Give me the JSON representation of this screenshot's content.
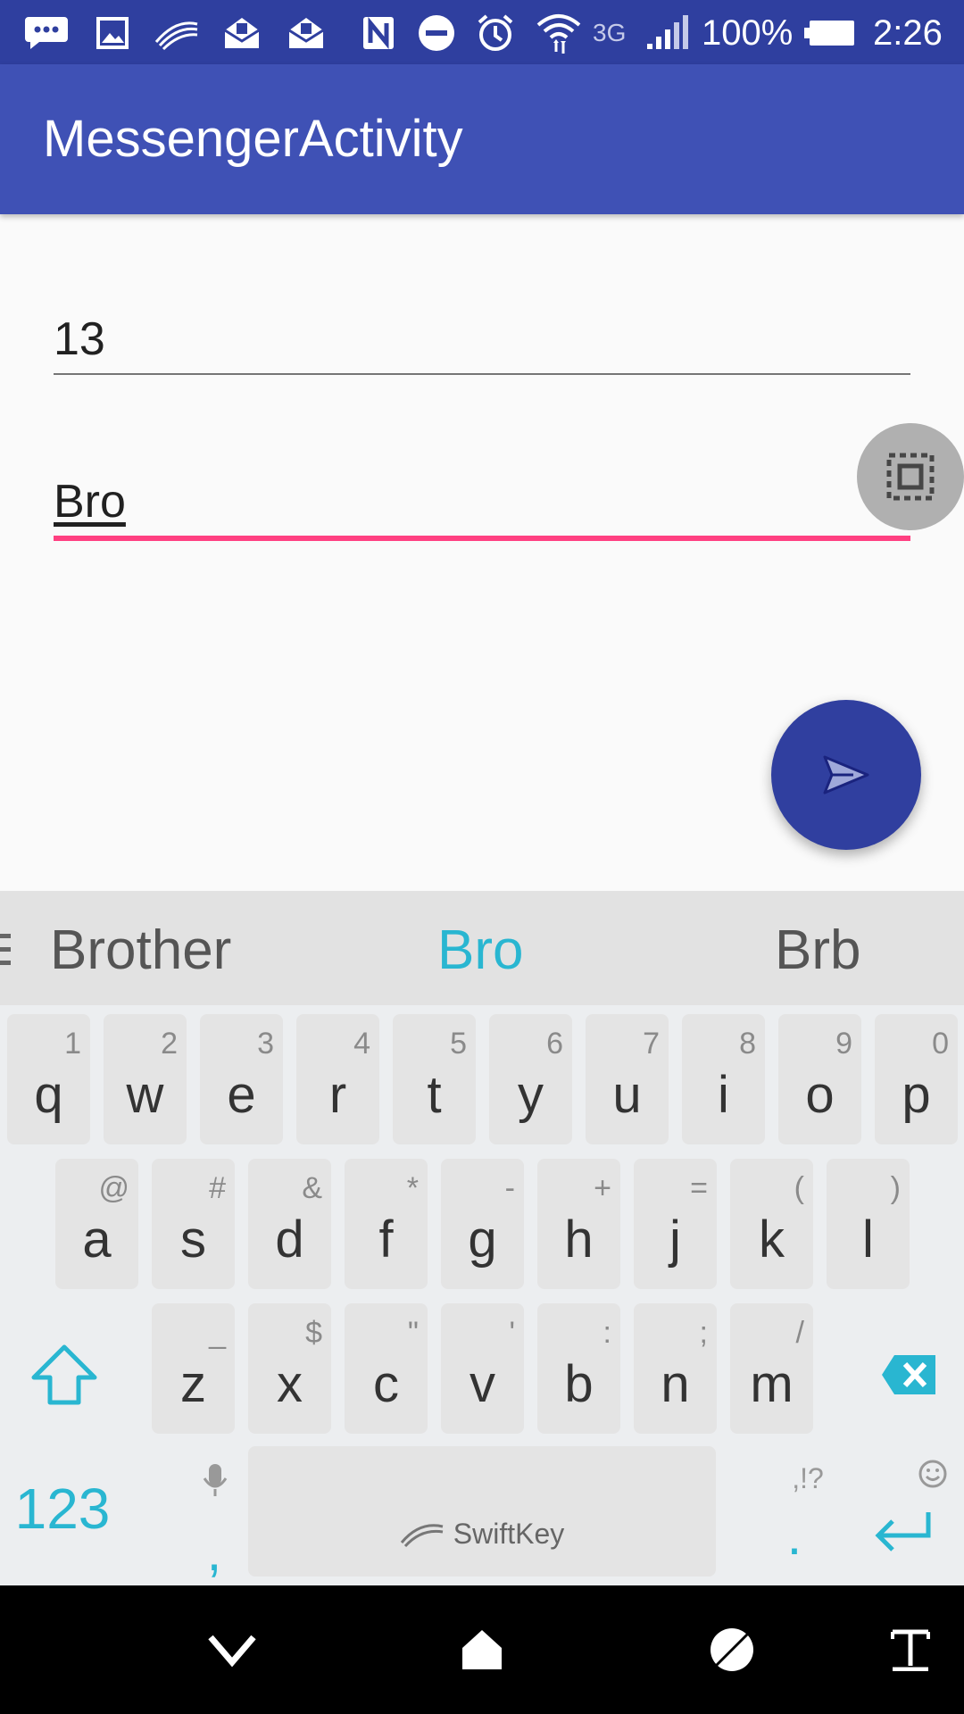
{
  "status_bar": {
    "network_type": "3G",
    "battery": "100%",
    "time": "2:26",
    "icons": [
      "more-icon",
      "image-icon",
      "swiftkey-icon",
      "email-icon",
      "email-icon",
      "nfc-icon",
      "do-not-disturb-icon",
      "alarm-icon",
      "wifi-icon",
      "signal-icon",
      "battery-icon"
    ]
  },
  "app_bar": {
    "title": "MessengerActivity"
  },
  "form": {
    "field1_value": "13",
    "field2_value": "Bro"
  },
  "colors": {
    "primary": "#3f51b5",
    "primary_dark": "#303f9f",
    "accent": "#ff4081",
    "keyboard_accent": "#29b6d1"
  },
  "keyboard": {
    "suggestions": [
      "Brother",
      "Bro",
      "Brb"
    ],
    "row1": [
      {
        "key": "q",
        "hint": "1"
      },
      {
        "key": "w",
        "hint": "2"
      },
      {
        "key": "e",
        "hint": "3"
      },
      {
        "key": "r",
        "hint": "4"
      },
      {
        "key": "t",
        "hint": "5"
      },
      {
        "key": "y",
        "hint": "6"
      },
      {
        "key": "u",
        "hint": "7"
      },
      {
        "key": "i",
        "hint": "8"
      },
      {
        "key": "o",
        "hint": "9"
      },
      {
        "key": "p",
        "hint": "0"
      }
    ],
    "row2": [
      {
        "key": "a",
        "hint": "@"
      },
      {
        "key": "s",
        "hint": "#"
      },
      {
        "key": "d",
        "hint": "&"
      },
      {
        "key": "f",
        "hint": "*"
      },
      {
        "key": "g",
        "hint": "-"
      },
      {
        "key": "h",
        "hint": "+"
      },
      {
        "key": "j",
        "hint": "="
      },
      {
        "key": "k",
        "hint": "("
      },
      {
        "key": "l",
        "hint": ")"
      }
    ],
    "row3": [
      {
        "key": "z",
        "hint": "_"
      },
      {
        "key": "x",
        "hint": "$"
      },
      {
        "key": "c",
        "hint": "\""
      },
      {
        "key": "v",
        "hint": "'"
      },
      {
        "key": "b",
        "hint": ":"
      },
      {
        "key": "n",
        "hint": ";"
      },
      {
        "key": "m",
        "hint": "/"
      }
    ],
    "numbers_label": "123",
    "comma_label": ",",
    "period_label": ".",
    "punct_hint": ",!?",
    "space_label": "SwiftKey"
  },
  "nav_bar": {
    "icons": [
      "back-icon",
      "home-icon",
      "recents-icon",
      "keyboard-toggle-icon"
    ]
  }
}
